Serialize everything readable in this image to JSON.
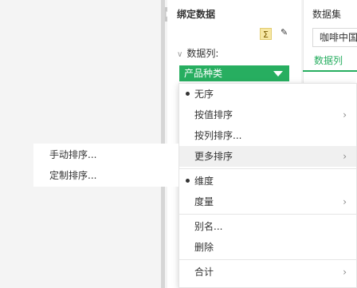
{
  "binding": {
    "title": "绑定数据",
    "section_label": "数据列:",
    "field": "产品种类",
    "sigma": "Σ",
    "eraser": "✎"
  },
  "dataset": {
    "title": "数据集",
    "selected": "咖啡中国",
    "tab": "数据列"
  },
  "menu": {
    "unsorted": "无序",
    "by_value": "按值排序",
    "by_column": "按列排序...",
    "more_sort": "更多排序",
    "dimension": "维度",
    "measure": "度量",
    "alias": "别名...",
    "delete": "删除",
    "total": "合计"
  },
  "submenu": {
    "manual": "手动排序...",
    "custom": "定制排序..."
  },
  "icons": {
    "collapse": "chevron-right-icon",
    "submenu_arrow": "chevron-right-icon"
  }
}
